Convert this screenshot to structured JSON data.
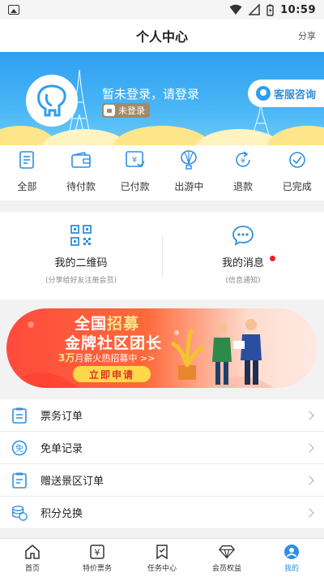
{
  "status_bar": {
    "time": "10:59"
  },
  "header": {
    "title": "个人中心",
    "share": "分享"
  },
  "profile": {
    "login_prompt": "暂未登录，请登录",
    "login_badge": "未登录",
    "service_button": "客服咨询"
  },
  "orders": [
    {
      "label": "全部",
      "icon": "document-icon"
    },
    {
      "label": "待付款",
      "icon": "wallet-icon"
    },
    {
      "label": "已付款",
      "icon": "paid-ticket-icon"
    },
    {
      "label": "出游中",
      "icon": "balloon-icon"
    },
    {
      "label": "退款",
      "icon": "refund-icon"
    },
    {
      "label": "已完成",
      "icon": "check-circle-icon"
    }
  ],
  "qr": {
    "title": "我的二维码",
    "subtitle": "(分享给好友注册会员)"
  },
  "messages": {
    "title": "我的消息",
    "subtitle": "(信息通知)",
    "has_unread": true
  },
  "recruit_banner": {
    "line1_a": "全国",
    "line1_b": "招募",
    "line2": "金牌社区团长",
    "salary_prefix": "3万",
    "salary_rest": "月薪火热招募中 >>",
    "apply_button": "立即申请"
  },
  "menu": [
    {
      "label": "票务订单",
      "icon": "ticket-order-icon"
    },
    {
      "label": "免单记录",
      "icon": "free-order-icon"
    },
    {
      "label": "赠送景区订单",
      "icon": "gift-order-icon"
    },
    {
      "label": "积分兑换",
      "icon": "coins-icon"
    }
  ],
  "bottom_nav": [
    {
      "label": "首页",
      "icon": "home-icon",
      "active": false
    },
    {
      "label": "特价票务",
      "icon": "ticket-icon",
      "active": false
    },
    {
      "label": "任务中心",
      "icon": "task-icon",
      "active": false
    },
    {
      "label": "会员权益",
      "icon": "diamond-icon",
      "active": false
    },
    {
      "label": "我的",
      "icon": "user-icon",
      "active": true
    }
  ],
  "colors": {
    "accent": "#2f8fe0",
    "banner_blue": "#2f9ef0",
    "red_dot": "#e8232d",
    "recruit_red": "#ff4a3d",
    "apply_yellow": "#ffd84a"
  }
}
